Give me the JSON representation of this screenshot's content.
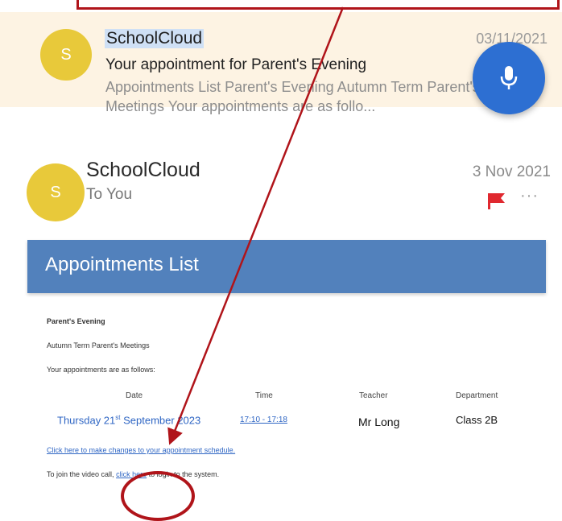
{
  "inbox_item": {
    "avatar_letter": "S",
    "sender": "SchoolCloud",
    "date": "03/11/2021",
    "subject": "Your appointment for Parent's Evening",
    "preview": "Appointments List Parent's Evening Autumn Term Parent's Meetings Your appointments are as follo..."
  },
  "email": {
    "avatar_letter": "S",
    "sender": "SchoolCloud",
    "to": "To You",
    "date": "3 Nov 2021",
    "more": "···"
  },
  "content": {
    "banner_title": "Appointments List",
    "event_title": "Parent's Evening",
    "term_line": "Autumn Term Parent's Meetings",
    "intro_line": "Your appointments are as follows:",
    "table": {
      "headers": [
        "Date",
        "Time",
        "Teacher",
        "Department"
      ],
      "row": {
        "date_prefix": "Thursday 21",
        "date_sup": "st",
        "date_suffix": " September 2023",
        "time": "17:10 - 17:18",
        "teacher": "Mr Long",
        "department": "Class 2B"
      }
    },
    "schedule_link": "Click here to make changes to your appointment schedule.",
    "video_prefix": "To join the video call,",
    "video_link": "click here",
    "video_suffix": "to login to the system."
  },
  "colors": {
    "banner": "#5281bc",
    "annotation": "#b0141a",
    "avatar": "#e8c93a",
    "mic_button": "#2d6fd2",
    "flag": "#e0282f",
    "highlight_row": "#fdf3e3"
  },
  "icons": {
    "mic": "microphone-icon",
    "flag": "flag-icon",
    "more": "more-horizontal-icon"
  }
}
